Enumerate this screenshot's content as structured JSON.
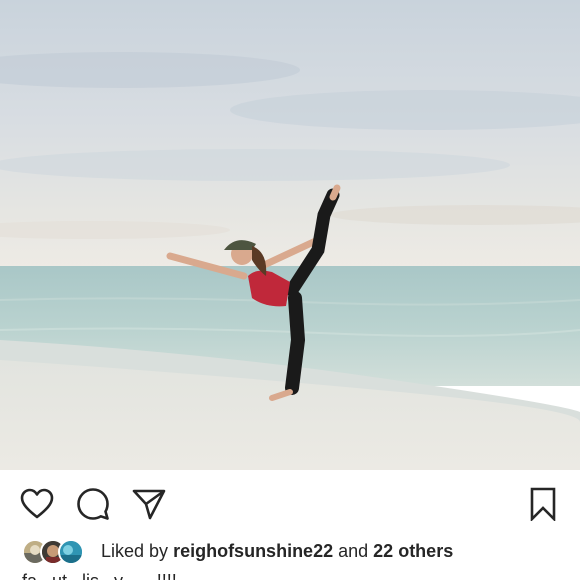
{
  "post": {
    "photo_alt": "Woman in a standing yoga pose on the beach",
    "actions": {
      "like_icon": "heart-outline-icon",
      "comment_icon": "comment-bubble-icon",
      "share_icon": "paper-plane-icon",
      "save_icon": "bookmark-outline-icon"
    },
    "likes": {
      "prefix": "Liked by",
      "user": "reighofsunshine22",
      "conjunction": "and",
      "others": "22 others"
    },
    "caption_partial": "fa...ut...lis...y.......!!!!"
  },
  "colors": {
    "text": "#262626",
    "background": "#ffffff"
  }
}
